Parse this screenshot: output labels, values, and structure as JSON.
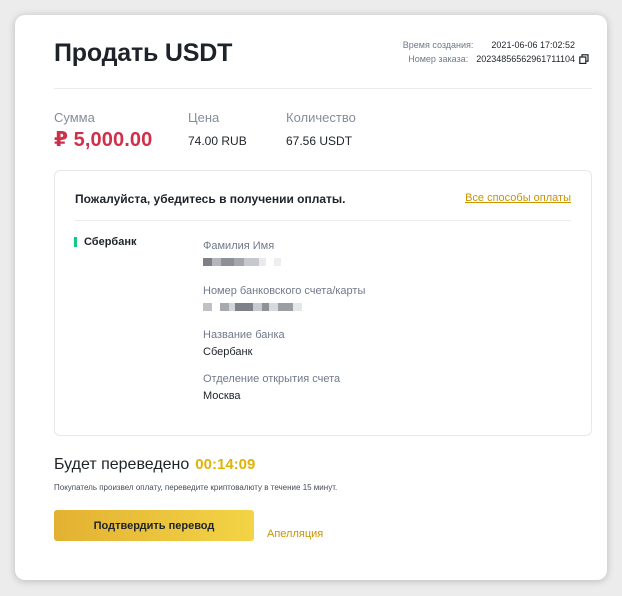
{
  "header": {
    "title": "Продать USDT",
    "created_label": "Время создания:",
    "created_value": "2021-06-06 17:02:52",
    "order_label": "Номер заказа:",
    "order_value": "20234856562961711104",
    "copy_icon": "copy-icon"
  },
  "summary": {
    "amount_label": "Сумма",
    "amount_value": "₽ 5,000.00",
    "price_label": "Цена",
    "price_value": "74.00 RUB",
    "quantity_label": "Количество",
    "quantity_value": "67.56 USDT"
  },
  "payment": {
    "heading": "Пожалуйста, убедитесь в получении оплаты.",
    "all_methods_link": "Все способы оплаты",
    "bank_tag": "Сбербанк",
    "fields": [
      {
        "label": "Фамилия Имя",
        "value": ""
      },
      {
        "label": "Номер банковского счета/карты",
        "value": ""
      },
      {
        "label": "Название банка",
        "value": "Сбербанк"
      },
      {
        "label": "Отделение открытия счета",
        "value": "Москва"
      }
    ]
  },
  "transfer": {
    "label": "Будет переведено",
    "timer": "00:14:09",
    "hint": "Покупатель произвел оплату, переведите криптовалюту в течение 15 минут."
  },
  "actions": {
    "confirm_label": "Подтвердить перевод",
    "appeal_label": "Апелляция"
  },
  "colors": {
    "amount": "#cf304a",
    "accent": "#f0b90b",
    "link": "#c99400",
    "bank_marker": "#0ecb81"
  }
}
